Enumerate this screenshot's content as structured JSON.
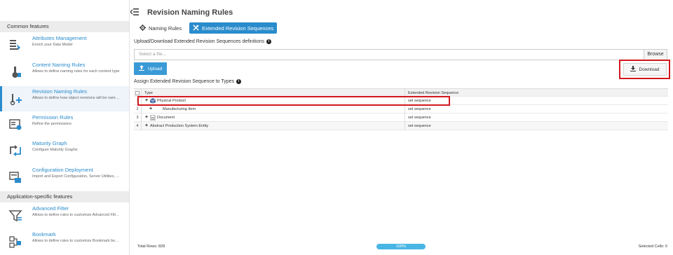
{
  "sidebar": {
    "common_header": "Common features",
    "app_header": "Application-specific features",
    "items": [
      {
        "title": "Attributes Management",
        "desc": "Enrich your Data Model",
        "icon": "attributes-icon"
      },
      {
        "title": "Content Naming Rules",
        "desc": "Allows to define naming rules for each content type",
        "icon": "content-naming-icon"
      },
      {
        "title": "Revision Naming Rules",
        "desc": "Allows to define how object revisions will be name...",
        "icon": "revision-naming-icon"
      },
      {
        "title": "Permission Rules",
        "desc": "Refine the permissions",
        "icon": "permission-icon"
      },
      {
        "title": "Maturity Graph",
        "desc": "Configure Maturity Graphs",
        "icon": "maturity-graph-icon"
      },
      {
        "title": "Configuration Deployment",
        "desc": "Import and Export Configuration, Server Utilities, ...",
        "icon": "deployment-icon"
      },
      {
        "title": "Advanced Filter",
        "desc": "Allows to define rules to customize Advanced Filte...",
        "icon": "filter-icon"
      },
      {
        "title": "Bookmark",
        "desc": "Allows to define rules to customize Bookmark beh...",
        "icon": "bookmark-icon"
      }
    ]
  },
  "header": {
    "title": "Revision Naming Rules"
  },
  "tabs": [
    {
      "label": "Naming Rules",
      "icon": "gear-icon"
    },
    {
      "label": "Extended Revision Sequences",
      "icon": "tools-icon"
    }
  ],
  "upload": {
    "label": "Upload/Download Extended Revision Sequences definitions",
    "placeholder": "Select a file...",
    "browse_label": "Browse",
    "upload_label": "Upload",
    "download_label": "Download"
  },
  "assign": {
    "label": "Assign Extended Revision Sequence to Types"
  },
  "grid": {
    "columns": [
      "Type",
      "Extended Revision Sequence"
    ],
    "rows": [
      {
        "num": "1",
        "type": "Physical Product",
        "seq": "set sequence",
        "indent": 0
      },
      {
        "num": "2",
        "type": "Manufacturing Item",
        "seq": "set sequence",
        "indent": 1
      },
      {
        "num": "3",
        "type": "Document",
        "seq": "set sequence",
        "indent": 0
      },
      {
        "num": "4",
        "type": "Abstract Production System Entity",
        "seq": "set sequence",
        "indent": 0
      }
    ]
  },
  "footer": {
    "total_rows": "Total Rows: 828",
    "progress": "100%",
    "selected_cells": "Selected Cells: 0"
  },
  "colors": {
    "accent": "#2a8ccc",
    "highlight": "#d3181e"
  }
}
